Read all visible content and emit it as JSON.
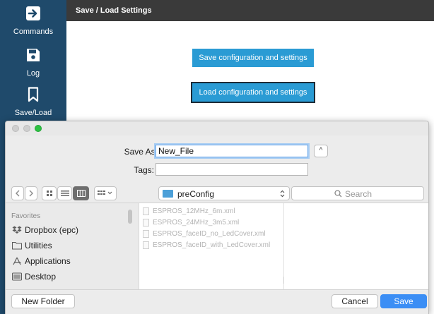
{
  "sidebar": {
    "items": [
      {
        "label": "Commands",
        "icon": "arrow-right-icon"
      },
      {
        "label": "Log",
        "icon": "floppy-disk-icon"
      },
      {
        "label": "Save/Load",
        "icon": "bookmark-icon"
      }
    ]
  },
  "header": {
    "title": "Save / Load Settings"
  },
  "main": {
    "save_button": "Save configuration and settings",
    "load_button": "Load configuration and settings"
  },
  "dialog": {
    "save_as_label": "Save As:",
    "save_as_value": "New_File",
    "tags_label": "Tags:",
    "tags_value": "",
    "expand_icon": "^",
    "location": "preConfig",
    "search_placeholder": "Search",
    "favorites_header": "Favorites",
    "favorites": [
      {
        "label": "Dropbox (epc)",
        "icon": "dropbox-icon"
      },
      {
        "label": "Utilities",
        "icon": "folder-icon"
      },
      {
        "label": "Applications",
        "icon": "applications-icon"
      },
      {
        "label": "Desktop",
        "icon": "desktop-icon"
      }
    ],
    "files": [
      "ESPROS_12MHz_6m.xml",
      "ESPROS_24MHz_3m5.xml",
      "ESPROS_faceID_no_LedCover.xml",
      "ESPROS_faceID_with_LedCover.xml"
    ],
    "new_folder_button": "New Folder",
    "cancel_button": "Cancel",
    "save_button": "Save"
  },
  "colors": {
    "sidebar_bg": "#1f4a6b",
    "header_bg": "#3a3a3a",
    "accent_button": "#2a9bd4",
    "primary_dialog_button": "#3b8ef5"
  }
}
